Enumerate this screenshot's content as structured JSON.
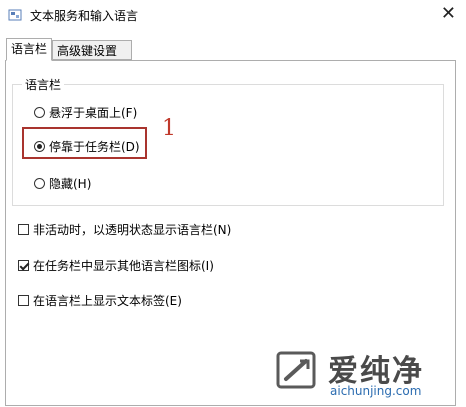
{
  "window": {
    "title": "文本服务和输入语言",
    "close_symbol": "✕"
  },
  "tabs": [
    {
      "label": "语言栏",
      "active": true
    },
    {
      "label": "高级键设置",
      "active": false
    }
  ],
  "group": {
    "title": "语言栏",
    "radios": [
      {
        "label": "悬浮于桌面上(F)",
        "checked": false
      },
      {
        "label": "停靠于任务栏(D)",
        "checked": true
      },
      {
        "label": "隐藏(H)",
        "checked": false
      }
    ]
  },
  "annotation": "1",
  "checkboxes": [
    {
      "label": "非活动时，以透明状态显示语言栏(N)",
      "checked": false
    },
    {
      "label": "在任务栏中显示其他语言栏图标(I)",
      "checked": true
    },
    {
      "label": "在语言栏上显示文本标签(E)",
      "checked": false
    }
  ],
  "watermark": {
    "text": "爱纯净",
    "url": "aichunjing.com"
  }
}
